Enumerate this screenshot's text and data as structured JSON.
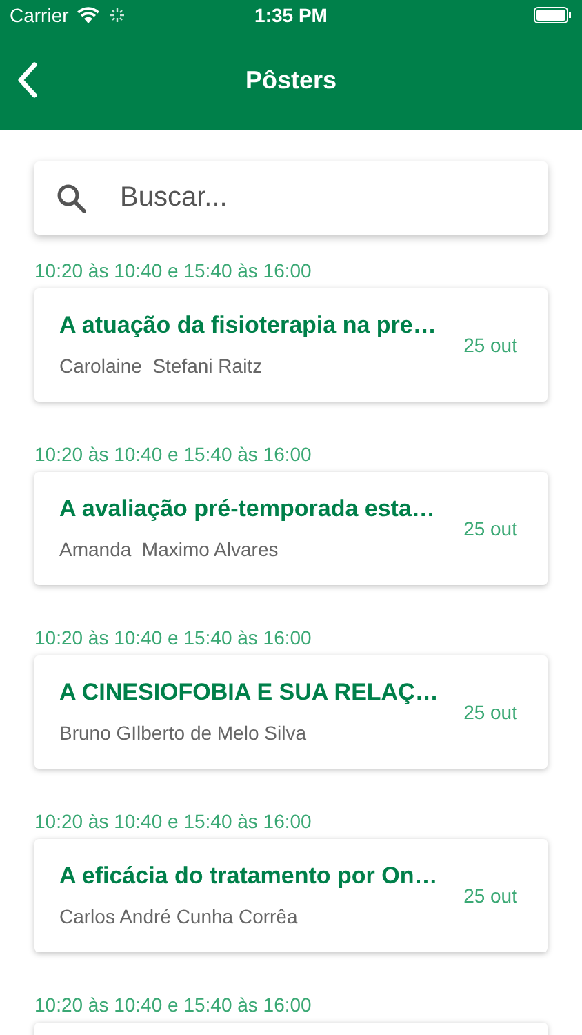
{
  "status_bar": {
    "carrier": "Carrier",
    "time": "1:35 PM"
  },
  "nav": {
    "title": "Pôsters"
  },
  "search": {
    "placeholder": "Buscar..."
  },
  "posters": [
    {
      "time": "10:20 às 10:40 e 15:40 às 16:00",
      "title": "A atuação da fisioterapia na pre…",
      "authors": "Carolaine  Stefani Raitz",
      "date": "25 out"
    },
    {
      "time": "10:20 às 10:40 e 15:40 às 16:00",
      "title": "A avaliação pré-temporada esta…",
      "authors": "Amanda  Maximo Alvares",
      "date": "25 out"
    },
    {
      "time": "10:20 às 10:40 e 15:40 às 16:00",
      "title": "A CINESIOFOBIA E SUA RELAÇ…",
      "authors": "Bruno GIlberto de Melo Silva",
      "date": "25 out"
    },
    {
      "time": "10:20 às 10:40 e 15:40 às 16:00",
      "title": "A eficácia do tratamento por On…",
      "authors": "Carlos André Cunha Corrêa",
      "date": "25 out"
    },
    {
      "time": "10:20 às 10:40 e 15:40 às 16:00"
    }
  ]
}
